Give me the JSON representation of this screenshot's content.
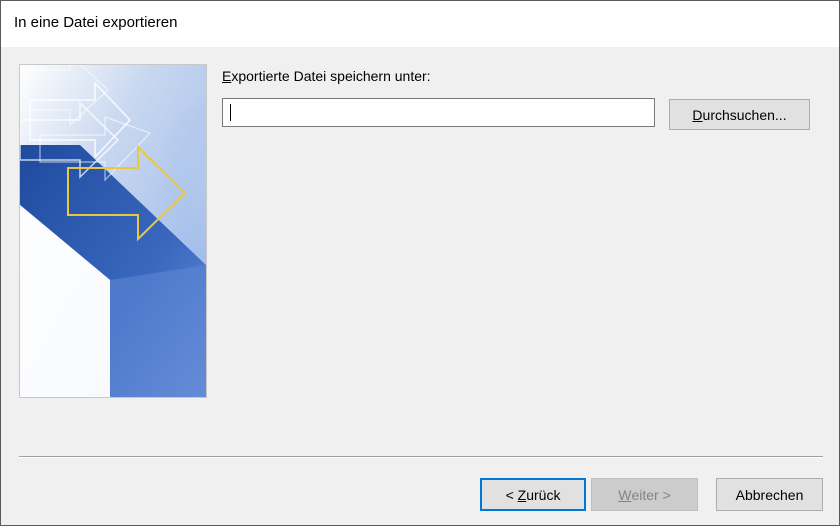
{
  "window": {
    "title": "In eine Datei exportieren"
  },
  "form": {
    "label_mnemonic": "E",
    "label_rest": "xportierte Datei speichern unter:",
    "path_value": "",
    "browse_mnemonic": "D",
    "browse_rest": "urchsuchen..."
  },
  "buttons": {
    "back_prefix": "< ",
    "back_mnemonic": "Z",
    "back_rest": "urück",
    "next_mnemonic": "W",
    "next_rest": "eiter >",
    "next_enabled": false,
    "cancel_label": "Abbrechen"
  },
  "colors": {
    "focus_border": "#0078d7",
    "dialog_bg": "#f0f0f0",
    "wizard_blue": "#2f5bb0",
    "arrow_yellow": "#e8c840"
  },
  "icons": {
    "wizard_image": "export-wizard-arrows-graphic"
  }
}
